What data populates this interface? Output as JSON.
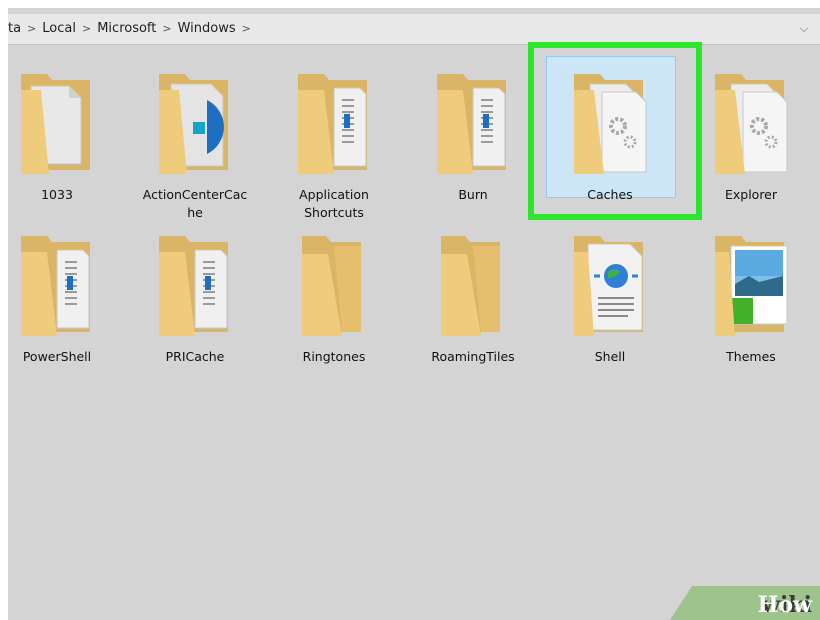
{
  "breadcrumbs": [
    "ta",
    "Local",
    "Microsoft",
    "Windows"
  ],
  "separator": ">",
  "dropdown_icon": "chevron-down-icon",
  "items": [
    {
      "label": "1033",
      "icon": "folder-document-icon"
    },
    {
      "label": "ActionCenterCac he",
      "label_lines": [
        "ActionCenterCac",
        "he"
      ],
      "icon": "folder-disc-icon"
    },
    {
      "label": "Application Shortcuts",
      "label_lines": [
        "Application",
        "Shortcuts"
      ],
      "icon": "folder-files-icon"
    },
    {
      "label": "Burn",
      "icon": "folder-files-icon"
    },
    {
      "label": "Caches",
      "icon": "folder-gear-icon",
      "selected": true
    },
    {
      "label": "Explorer",
      "icon": "folder-gear-icon"
    },
    {
      "label": "PowerShell",
      "icon": "folder-files-icon"
    },
    {
      "label": "PRICache",
      "icon": "folder-files-icon"
    },
    {
      "label": "Ringtones",
      "icon": "folder-empty-icon"
    },
    {
      "label": "RoamingTiles",
      "icon": "folder-empty-icon"
    },
    {
      "label": "Shell",
      "icon": "folder-globe-icon"
    },
    {
      "label": "Themes",
      "icon": "folder-picture-icon"
    }
  ],
  "highlight_color": "#2ee52e",
  "selection_color": "#cde6f7",
  "watermark": {
    "wiki": "wiki",
    "how": "How"
  }
}
